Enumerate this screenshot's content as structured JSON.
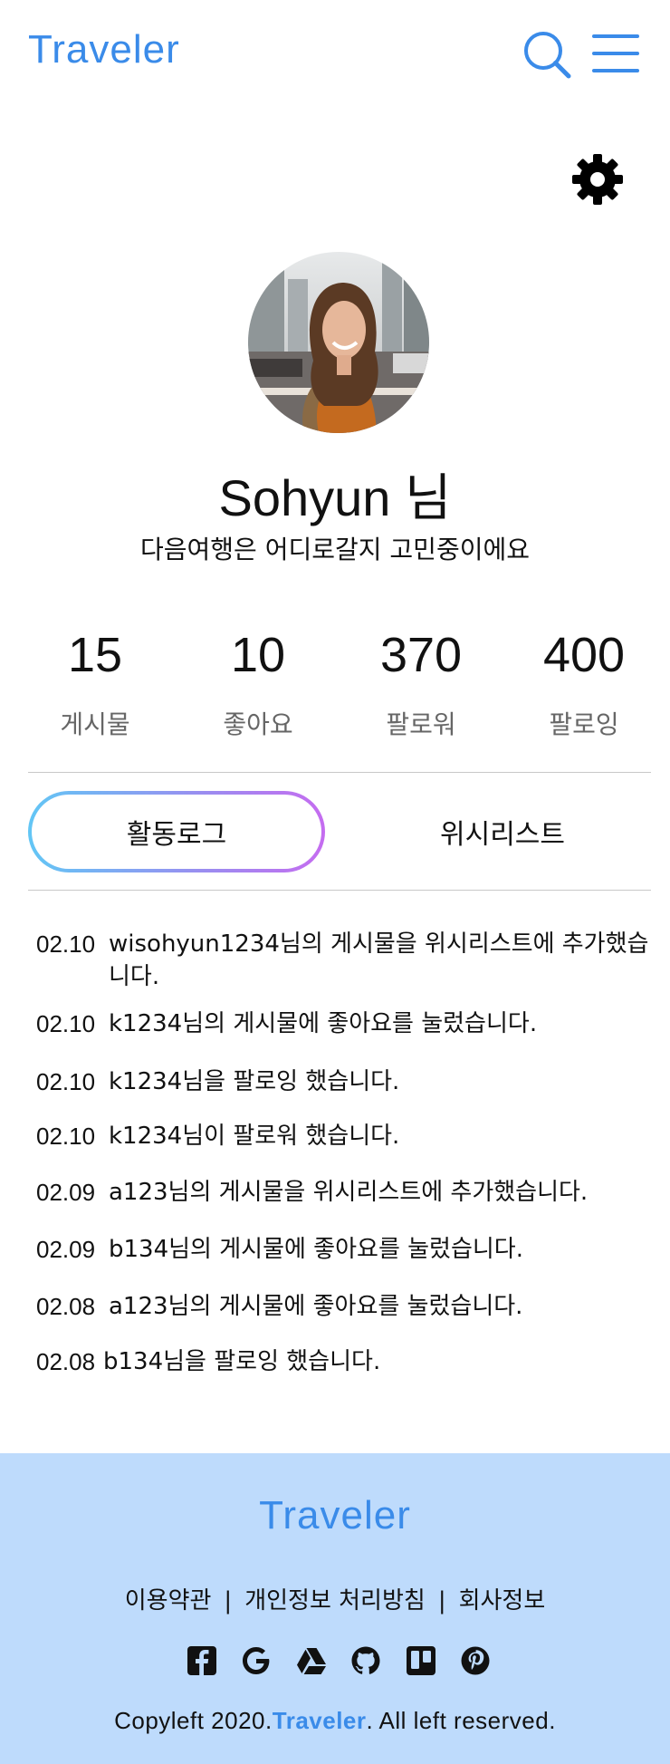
{
  "header": {
    "logo": "Traveler",
    "icons": {
      "search": "search-icon",
      "menu": "hamburger-menu-icon",
      "settings": "gear-icon"
    }
  },
  "profile": {
    "name": "Sohyun 님",
    "bio": "다음여행은 어디로갈지 고민중이에요",
    "avatar_icon": "profile-photo"
  },
  "stats": [
    {
      "value": "15",
      "label": "게시물"
    },
    {
      "value": "10",
      "label": "좋아요"
    },
    {
      "value": "370",
      "label": "팔로워"
    },
    {
      "value": "400",
      "label": "팔로잉"
    }
  ],
  "tabs": [
    {
      "label": "활동로그",
      "active": true
    },
    {
      "label": "위시리스트",
      "active": false
    }
  ],
  "activity_log": [
    {
      "date": "02.10",
      "text": "wisohyun1234님의 게시물을 위시리스트에 추가했습니다."
    },
    {
      "date": "02.10",
      "text": "k1234님의 게시물에 좋아요를 눌렀습니다."
    },
    {
      "date": "02.10",
      "text": "k1234님을 팔로잉 했습니다."
    },
    {
      "date": "02.10",
      "text": "k1234님이 팔로워 했습니다."
    },
    {
      "date": "02.09",
      "text": "a123님의 게시물을 위시리스트에 추가했습니다."
    },
    {
      "date": "02.09",
      "text": "b134님의 게시물에 좋아요를 눌렀습니다."
    },
    {
      "date": "02.08",
      "text": "a123님의 게시물에 좋아요를 눌렀습니다."
    },
    {
      "date": "02.08",
      "text": "b134님을 팔로잉 했습니다."
    }
  ],
  "footer": {
    "logo": "Traveler",
    "links": [
      "이용약관",
      "개인정보 처리방침",
      "회사정보"
    ],
    "link_separator": "|",
    "social_icons": [
      "facebook-icon",
      "google-icon",
      "google-drive-icon",
      "github-icon",
      "trello-icon",
      "pinterest-icon"
    ],
    "copyright_prefix": "Copyleft 2020.",
    "copyright_brand": "Traveler",
    "copyright_suffix": ". All left reserved."
  },
  "colors": {
    "brand": "#3a8be9",
    "footer_bg": "#bedbfc",
    "tab_gradient_start": "#62c6f5",
    "tab_gradient_end": "#c56cf0"
  }
}
